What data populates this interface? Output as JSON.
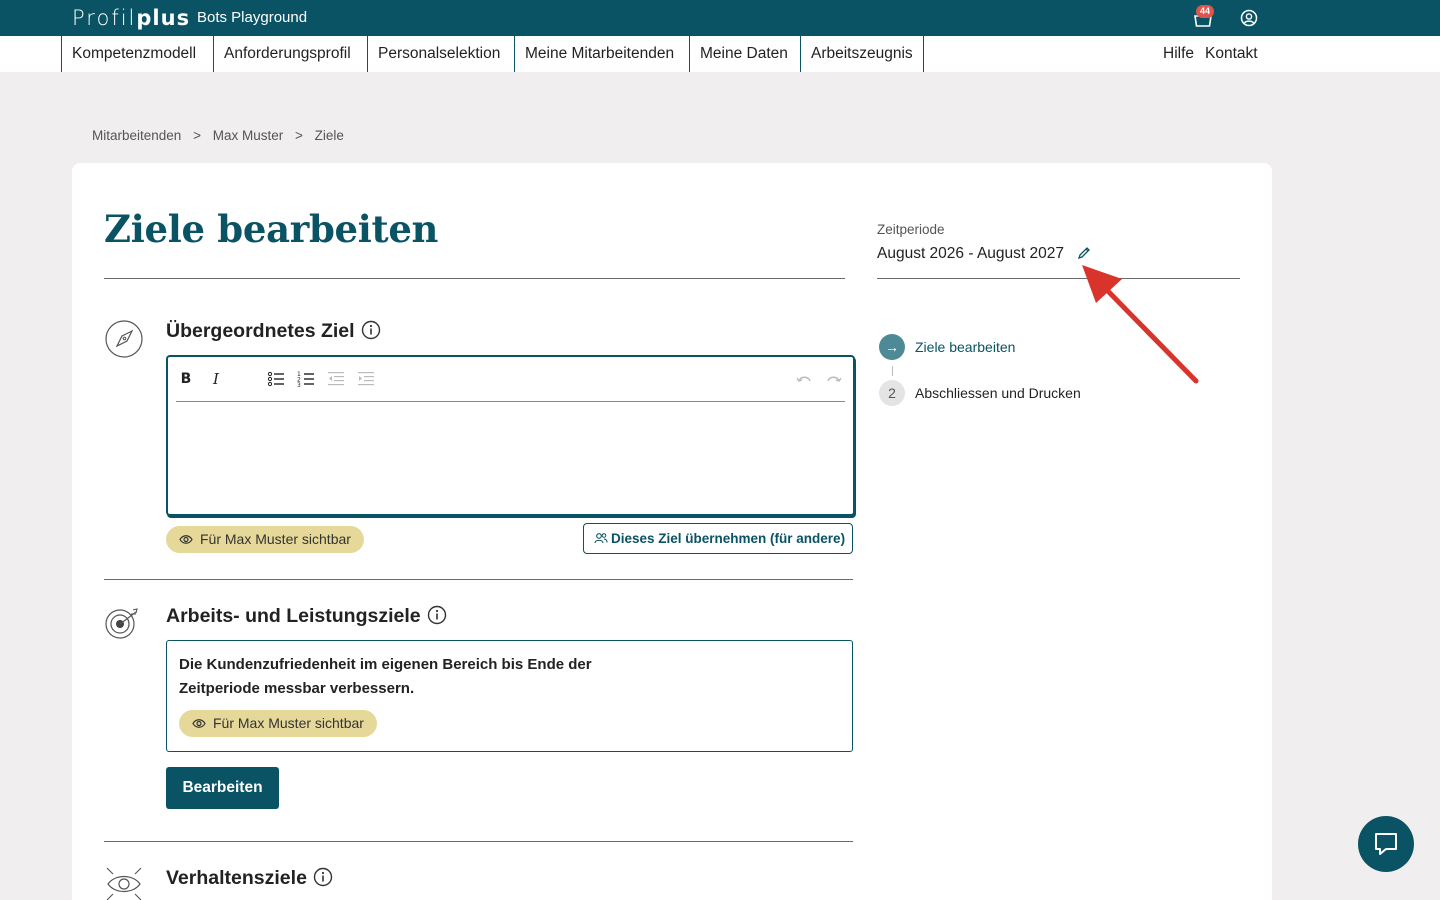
{
  "topbar": {
    "logo_light": "Profil",
    "logo_bold": "plus",
    "app_name": "Bots Playground",
    "cart_badge": "44"
  },
  "nav": {
    "items": [
      "Kompetenzmodell",
      "Anforderungsprofil",
      "Personalselektion",
      "Meine Mitarbeitenden",
      "Meine Daten",
      "Arbeitszeugnis"
    ],
    "help": "Hilfe",
    "contact": "Kontakt"
  },
  "breadcrumb": [
    "Mitarbeitenden",
    "Max Muster",
    "Ziele"
  ],
  "breadcrumb_sep": ">",
  "page": {
    "title": "Ziele bearbeiten"
  },
  "period": {
    "label": "Zeitperiode",
    "value": "August 2026 - August 2027"
  },
  "steps": [
    {
      "marker": "→",
      "label": "Ziele bearbeiten",
      "active": true
    },
    {
      "marker": "2",
      "label": "Abschliessen und Drucken",
      "active": false
    }
  ],
  "sections": {
    "overarching": {
      "title": "Übergeordnetes Ziel",
      "visibility": "Für Max Muster sichtbar",
      "adopt_button": "Dieses Ziel übernehmen (für andere)"
    },
    "performance": {
      "title": "Arbeits- und Leistungsziele",
      "goal_text": "Die Kundenzufriedenheit im eigenen Bereich bis Ende der Zeitperiode messbar verbessern.",
      "visibility": "Für Max Muster sichtbar",
      "edit_button": "Bearbeiten"
    },
    "behavior": {
      "title": "Verhaltensziele"
    }
  },
  "toolbar": {
    "bold": "B",
    "italic": "I"
  },
  "colors": {
    "brand": "#0a5364",
    "pill": "#e6d899",
    "badge": "#e0544e",
    "annotation_arrow": "#d9342b"
  }
}
